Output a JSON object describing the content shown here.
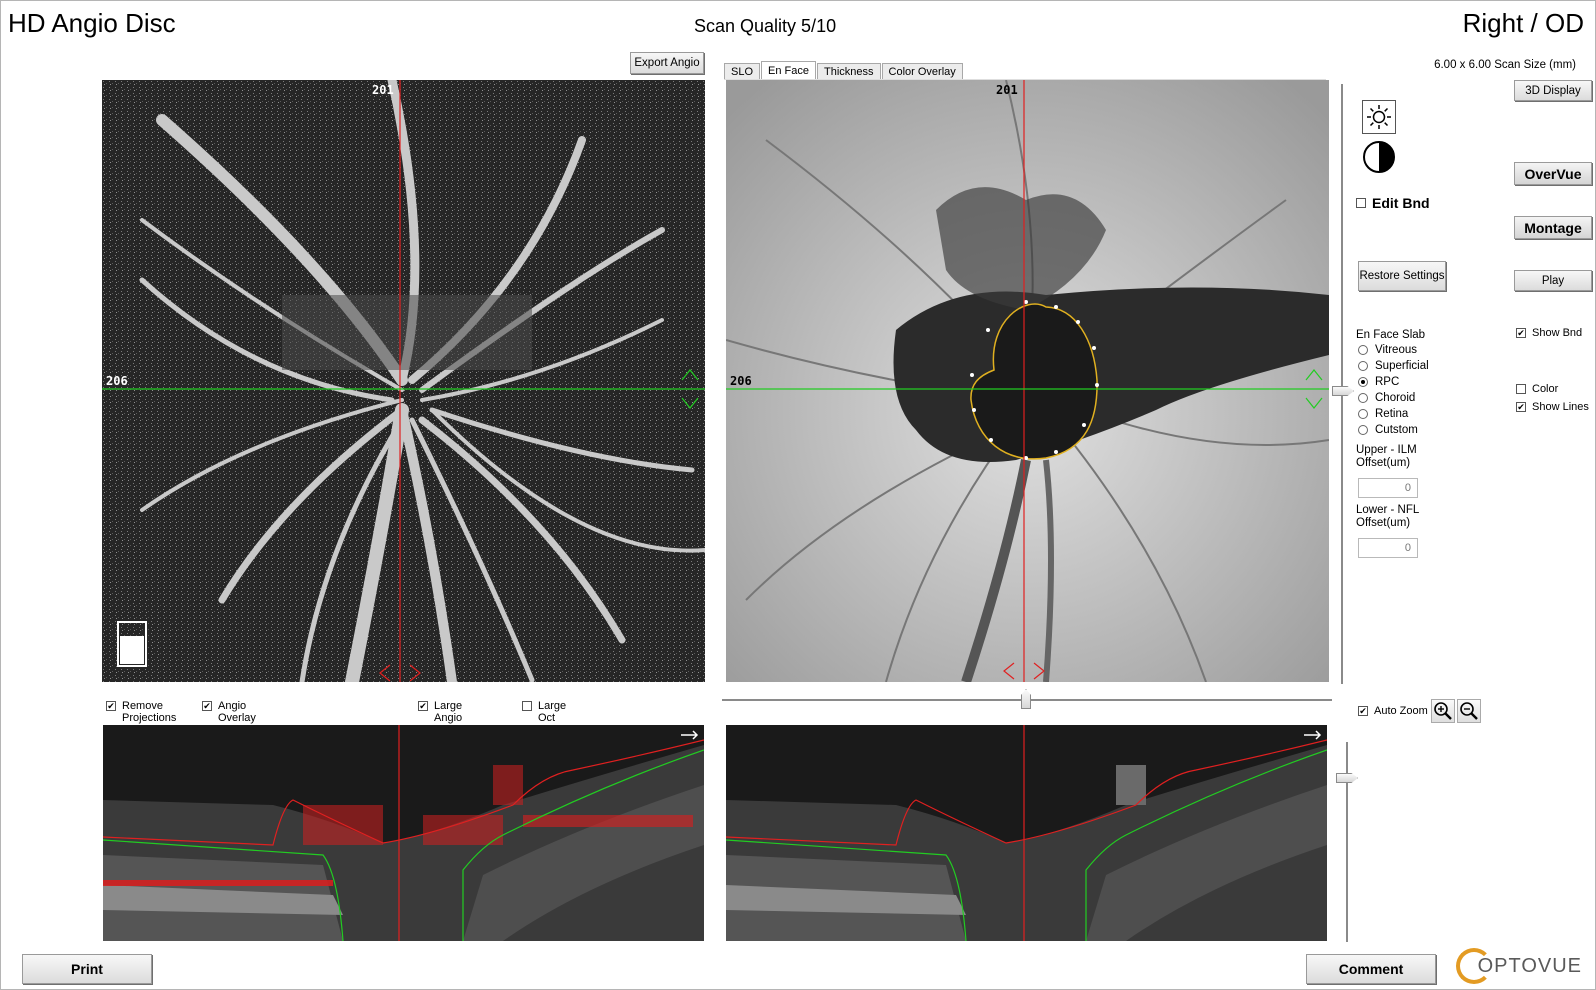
{
  "header": {
    "title": "HD Angio Disc",
    "scan_quality": "Scan Quality 5/10",
    "eye": "Right / OD",
    "scan_size": "6.00 x 6.00 Scan Size (mm)"
  },
  "left_panel": {
    "export_label": "Export Angio",
    "marker_top": "201",
    "marker_left": "206"
  },
  "right_panel": {
    "tabs": [
      {
        "label": "SLO",
        "active": false
      },
      {
        "label": "En Face",
        "active": true
      },
      {
        "label": "Thickness",
        "active": false
      },
      {
        "label": "Color Overlay",
        "active": false
      }
    ],
    "marker_top": "201",
    "marker_left": "206"
  },
  "sidebar": {
    "display_3d": "3D Display",
    "edit_bnd": "Edit Bnd",
    "overvue": "OverVue",
    "montage": "Montage",
    "restore": "Restore Settings",
    "play": "Play",
    "show_bnd": "Show Bnd",
    "color": "Color",
    "show_lines": "Show Lines",
    "slab_title": "En Face Slab",
    "slabs": [
      {
        "label": "Vitreous",
        "selected": false
      },
      {
        "label": "Superficial",
        "selected": false
      },
      {
        "label": "RPC",
        "selected": true
      },
      {
        "label": "Choroid",
        "selected": false
      },
      {
        "label": "Retina",
        "selected": false
      },
      {
        "label": "Cutstom",
        "selected": false
      }
    ],
    "upper_label_1": "Upper - ILM",
    "upper_label_2": "Offset(um)",
    "upper_value": "0",
    "lower_label_1": "Lower - NFL",
    "lower_label_2": "Offset(um)",
    "lower_value": "0",
    "auto_zoom": "Auto Zoom"
  },
  "bscan_options": {
    "remove_1": "Remove",
    "remove_2": "Projections",
    "angio_1": "Angio",
    "angio_2": "Overlay",
    "large_angio_1": "Large",
    "large_angio_2": "Angio",
    "large_oct_1": "Large",
    "large_oct_2": "Oct"
  },
  "footer": {
    "print": "Print",
    "comment": "Comment",
    "logo": "OPTOVUE"
  },
  "colors": {
    "crosshair_v": "#e02020",
    "crosshair_h": "#22cc22",
    "boundary": "#e0b020"
  }
}
